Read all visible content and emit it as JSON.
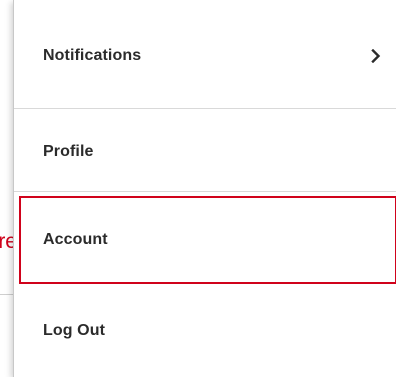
{
  "menu": {
    "items": [
      {
        "label": "Notifications",
        "has_submenu": true,
        "icon": "chevron-right-icon"
      },
      {
        "label": "Profile"
      },
      {
        "label": "Account",
        "highlighted": true
      },
      {
        "label": "Log Out"
      }
    ]
  },
  "annotation": {
    "callout_text": "re",
    "color": "#d0021b"
  }
}
